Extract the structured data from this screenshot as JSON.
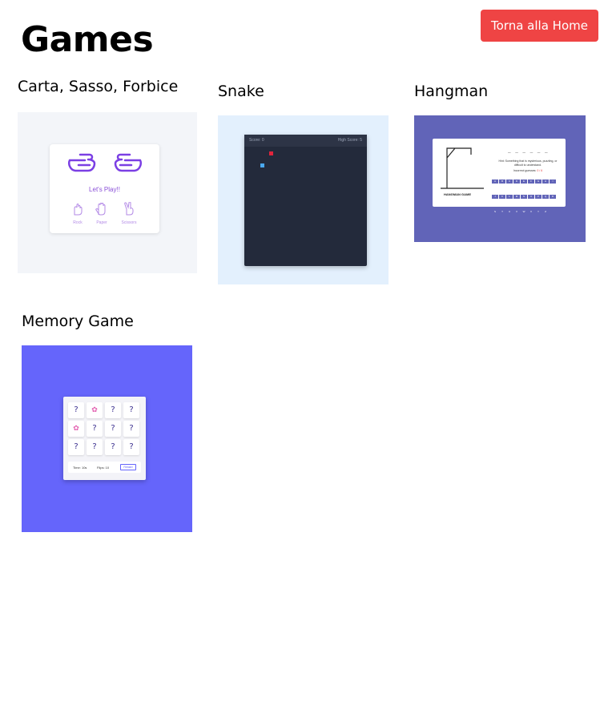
{
  "header": {
    "title": "Games",
    "home_button": "Torna alla Home"
  },
  "games": [
    {
      "title": "Carta, Sasso, Forbice",
      "preview": {
        "prompt": "Let's Play!!",
        "choices": [
          "Rock",
          "Paper",
          "Scissors"
        ]
      }
    },
    {
      "title": "Snake",
      "preview": {
        "score": "Score: 0",
        "high_score": "High Score: 5"
      }
    },
    {
      "title": "Hangman",
      "preview": {
        "blanks": "_ _ _ _ _ _",
        "hint": "Hint: Something that is mysterious, puzzling, or difficult to understand.",
        "guesses_label": "Incorrect guesses:",
        "guesses_value": "0 / 6",
        "caption": "HANGMAN GAME",
        "keys": [
          "A",
          "B",
          "C",
          "D",
          "E",
          "F",
          "G",
          "H",
          "I",
          "J",
          "K",
          "L",
          "M",
          "N",
          "O",
          "P",
          "Q",
          "R",
          "S",
          "T",
          "U",
          "V",
          "W",
          "X",
          "Y",
          "Z"
        ]
      }
    },
    {
      "title": "Memory Game",
      "preview": {
        "cells": [
          "?",
          "✿",
          "?",
          "?",
          "✿",
          "?",
          "?",
          "?",
          "?",
          "?",
          "?",
          "?"
        ],
        "time": "Time: 10s",
        "flips": "Flips: 10",
        "restart": "Restart"
      }
    }
  ],
  "colors": {
    "accent": "#ef4444",
    "rps": "#7b3fe4",
    "snake_bg": "#232a3b",
    "hangman": "#6164b8",
    "memory": "#6565fb"
  }
}
